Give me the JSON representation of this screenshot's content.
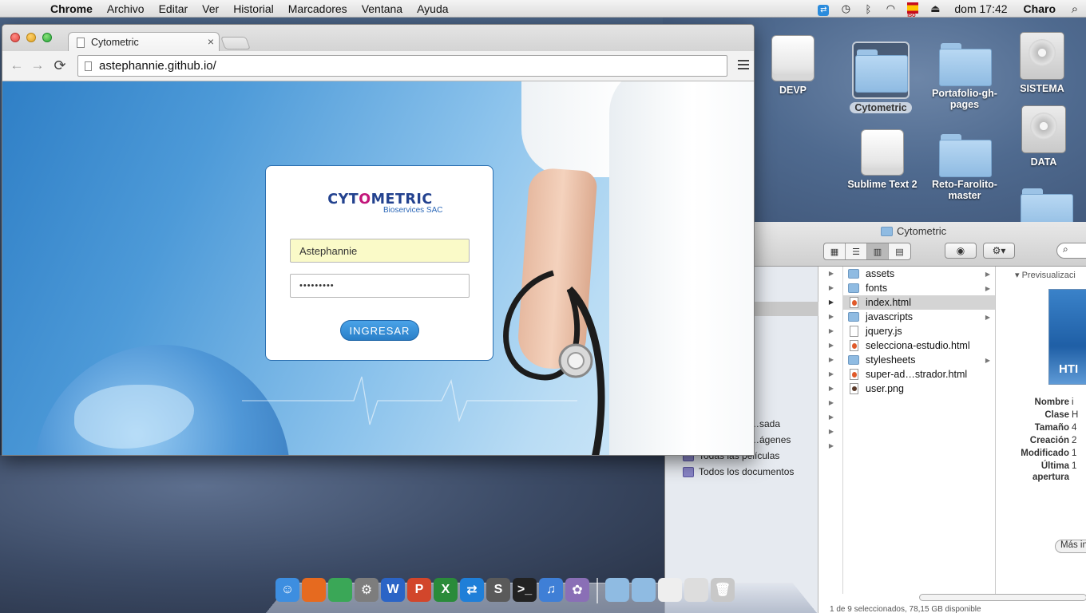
{
  "menubar": {
    "apple": "",
    "app_name": "Chrome",
    "items": [
      "Archivo",
      "Editar",
      "Ver",
      "Historial",
      "Marcadores",
      "Ventana",
      "Ayuda"
    ],
    "flag_label": "ISO",
    "clock": "dom 17:42",
    "user": "Charo"
  },
  "desktop": {
    "icons": [
      {
        "label": "DEVP",
        "kind": "drive"
      },
      {
        "label": "Cytometric",
        "kind": "folder"
      },
      {
        "label": "Portafolio-gh-pages",
        "kind": "folder"
      },
      {
        "label": "SISTEMA",
        "kind": "hdd"
      },
      {
        "label": "Sublime Text 2",
        "kind": "drive"
      },
      {
        "label": "Reto-Farolito-master",
        "kind": "folder"
      },
      {
        "label": "DATA",
        "kind": "hdd"
      }
    ]
  },
  "chrome": {
    "tab_title": "Cytometric",
    "tab_close": "×",
    "url": "astephannie.github.io/",
    "back": "←",
    "forward": "→",
    "reload": "⟳"
  },
  "page": {
    "logo_text_a": "CYT",
    "logo_text_o": "O",
    "logo_text_b": "METRIC",
    "logo_sub": "Bioservices SAC",
    "username": "Astephannie",
    "password_mask": "•••••••••",
    "login_button": "INGRESAR"
  },
  "finder": {
    "title": "Cytometric",
    "search": "",
    "sidebar": [
      "…sada",
      "…ágenes",
      "Todas las películas",
      "Todos los documentos"
    ],
    "files": [
      {
        "name": "assets",
        "type": "folder",
        "expandable": true
      },
      {
        "name": "fonts",
        "type": "folder",
        "expandable": true
      },
      {
        "name": "index.html",
        "type": "html",
        "expandable": false,
        "selected": true
      },
      {
        "name": "javascripts",
        "type": "folder",
        "expandable": true
      },
      {
        "name": "jquery.js",
        "type": "doc",
        "expandable": false
      },
      {
        "name": "selecciona-estudio.html",
        "type": "html",
        "expandable": false
      },
      {
        "name": "stylesheets",
        "type": "folder",
        "expandable": true
      },
      {
        "name": "super-ad…strador.html",
        "type": "html",
        "expandable": false
      },
      {
        "name": "user.png",
        "type": "img",
        "expandable": false
      }
    ],
    "preview_header": "Previsualizaci",
    "preview_badge": "HTI",
    "meta": [
      {
        "k": "Nombre",
        "v": "i"
      },
      {
        "k": "Clase",
        "v": "H"
      },
      {
        "k": "Tamaño",
        "v": "4"
      },
      {
        "k": "Creación",
        "v": "2"
      },
      {
        "k": "Modificado",
        "v": "1"
      },
      {
        "k": "Última",
        "v": "1"
      },
      {
        "k": "apertura",
        "v": ""
      }
    ],
    "more_info": "Más inform",
    "status": "1 de 9 seleccionados, 78,15 GB disponible"
  },
  "dock": {
    "apps": [
      {
        "name": "finder-icon",
        "glyph": "☺",
        "color": "#3d8ee0"
      },
      {
        "name": "firefox-icon",
        "glyph": "",
        "color": "#e66a1f"
      },
      {
        "name": "chrome-icon",
        "glyph": "",
        "color": "#3aa757"
      },
      {
        "name": "system-preferences-icon",
        "glyph": "⚙",
        "color": "#7d7d7d"
      },
      {
        "name": "word-icon",
        "glyph": "W",
        "color": "#2b64c6"
      },
      {
        "name": "powerpoint-icon",
        "glyph": "P",
        "color": "#d2462b"
      },
      {
        "name": "excel-icon",
        "glyph": "X",
        "color": "#2a8b3a"
      },
      {
        "name": "teamviewer-icon",
        "glyph": "⇄",
        "color": "#1f7fd8"
      },
      {
        "name": "sublime-icon",
        "glyph": "S",
        "color": "#5a5a5a"
      },
      {
        "name": "terminal-icon",
        "glyph": ">_",
        "color": "#222222"
      },
      {
        "name": "itunes-icon",
        "glyph": "♫",
        "color": "#3f7fd6"
      },
      {
        "name": "photo-icon",
        "glyph": "✿",
        "color": "#8a6fb6"
      },
      {
        "name": "applications-folder-icon",
        "glyph": "",
        "color": "#8fbbe2"
      },
      {
        "name": "documents-folder-icon",
        "glyph": "",
        "color": "#8fbbe2"
      },
      {
        "name": "document-stack-icon",
        "glyph": "",
        "color": "#eeeeee"
      },
      {
        "name": "downloads-stack-icon",
        "glyph": "",
        "color": "#dddddd"
      },
      {
        "name": "trash-icon",
        "glyph": "🗑",
        "color": "#c8c8c8"
      }
    ]
  }
}
